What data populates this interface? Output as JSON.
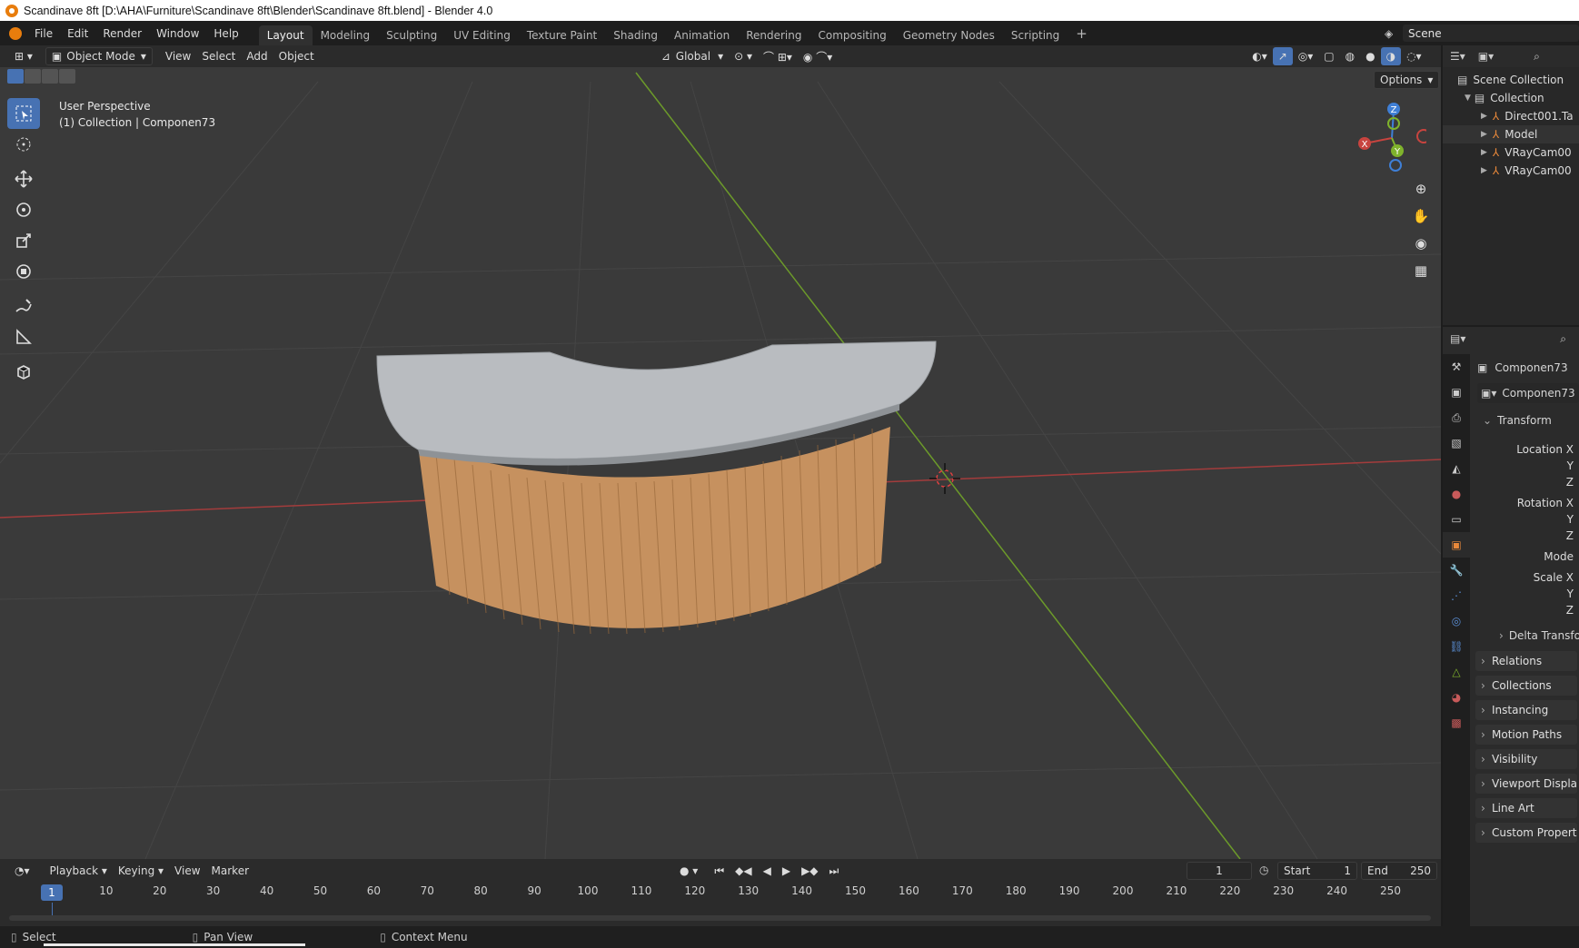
{
  "titlebar": {
    "title": "Scandinave 8ft [D:\\AHA\\Furniture\\Scandinave 8ft\\Blender\\Scandinave 8ft.blend] - Blender 4.0"
  },
  "menu": [
    "File",
    "Edit",
    "Render",
    "Window",
    "Help"
  ],
  "workspaces": [
    "Layout",
    "Modeling",
    "Sculpting",
    "UV Editing",
    "Texture Paint",
    "Shading",
    "Animation",
    "Rendering",
    "Compositing",
    "Geometry Nodes",
    "Scripting"
  ],
  "active_workspace": "Layout",
  "scene_name": "Scene",
  "viewport": {
    "mode": "Object Mode",
    "menus": [
      "View",
      "Select",
      "Add",
      "Object"
    ],
    "orientation": "Global",
    "options_label": "Options",
    "overlay_line1": "User Perspective",
    "overlay_line2": "(1) Collection | Componen73",
    "gizmo": {
      "x": "X",
      "y": "Y",
      "z": "Z"
    }
  },
  "outliner": {
    "root": "Scene Collection",
    "collection": "Collection",
    "items": [
      "Direct001.Ta",
      "Model",
      "VRayCam00",
      "VRayCam00"
    ]
  },
  "properties": {
    "object_name": "Componen73",
    "data_name": "Componen73",
    "transform_label": "Transform",
    "fields": [
      "Location X",
      "Y",
      "Z",
      "Rotation X",
      "Y",
      "Z",
      "Mode",
      "Scale X",
      "Y",
      "Z"
    ],
    "delta": "Delta Transform",
    "panels": [
      "Relations",
      "Collections",
      "Instancing",
      "Motion Paths",
      "Visibility",
      "Viewport Display",
      "Line Art",
      "Custom Properties"
    ]
  },
  "timeline": {
    "menus": [
      "Playback",
      "Keying",
      "View",
      "Marker"
    ],
    "current_frame": "1",
    "start_label": "Start",
    "start_value": "1",
    "end_label": "End",
    "end_value": "250",
    "ticks": [
      "10",
      "20",
      "30",
      "40",
      "50",
      "60",
      "70",
      "80",
      "90",
      "100",
      "110",
      "120",
      "130",
      "140",
      "150",
      "160",
      "170",
      "180",
      "190",
      "200",
      "210",
      "220",
      "230",
      "240",
      "250"
    ],
    "playhead_label": "1"
  },
  "statusbar": {
    "select": "Select",
    "pan": "Pan View",
    "context": "Context Menu"
  },
  "colors": {
    "accent": "#4772b3",
    "x_axis": "#c8443f",
    "y_axis": "#7fb32c",
    "z_axis": "#3f7fd6",
    "counter_top": "#b9bcc0",
    "wood": "#c6915f"
  }
}
